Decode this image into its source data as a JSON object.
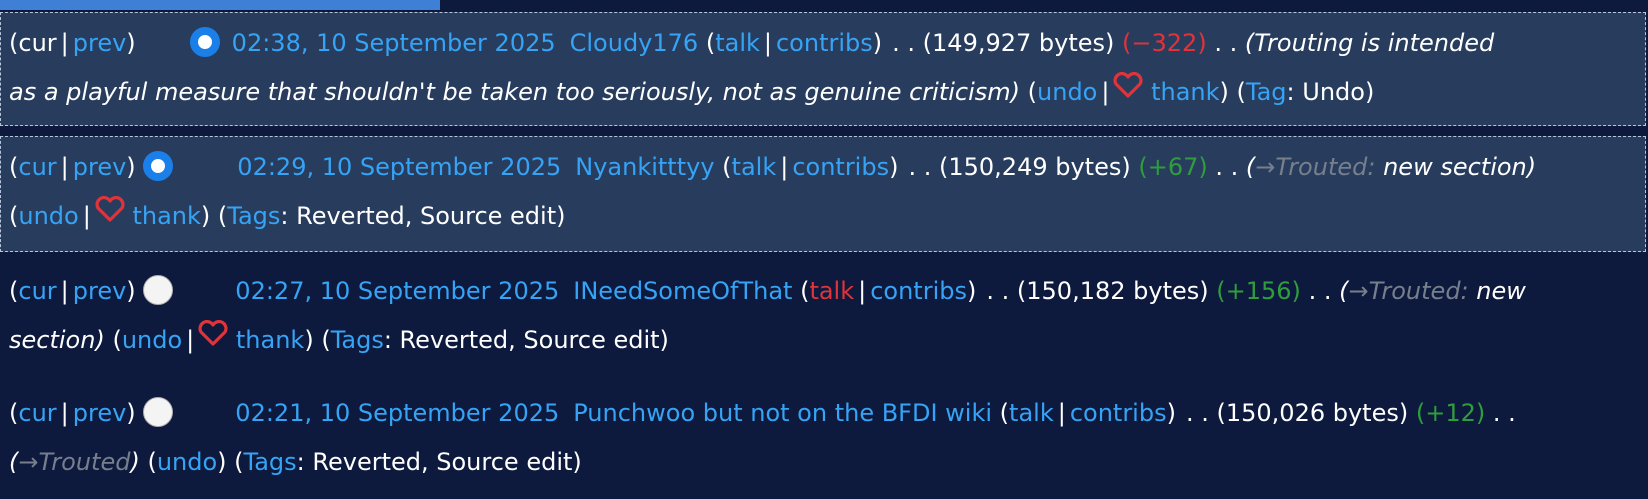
{
  "common": {
    "cur": "cur",
    "prev": "prev",
    "talk": "talk",
    "contribs": "contribs",
    "undo": "undo",
    "thank": "thank",
    "dots": ". .",
    "tag": "Tag",
    "tags": "Tags",
    "arrow": "→"
  },
  "entries": [
    {
      "timestamp": "02:38, 10 September 2025",
      "user": "Cloudy176",
      "bytes": "(149,927 bytes)",
      "diff": "(−322)",
      "summary_line1": "(Trouting is intended",
      "summary_line2": "as a playful measure that shouldn't be taken too seriously, not as genuine criticism)",
      "tag_values": ": Undo)"
    },
    {
      "timestamp": "02:29, 10 September 2025",
      "user": "Nyankitttyy",
      "bytes": "(150,249 bytes)",
      "diff": "(+67)",
      "section": "Trouted:",
      "summary_rest": "new section)",
      "tag_values": ": Reverted, Source edit)"
    },
    {
      "timestamp": "02:27, 10 September 2025",
      "user": "INeedSomeOfThat",
      "bytes": "(150,182 bytes)",
      "diff": "(+156)",
      "section": "Trouted:",
      "summary_rest_1": "new",
      "summary_rest_2": "section)",
      "tag_values": ": Reverted, Source edit)"
    },
    {
      "timestamp": "02:21, 10 September 2025",
      "user": "Punchwoo but not on the BFDI wiki",
      "bytes": "(150,026 bytes)",
      "diff": "(+12)",
      "section": "Trouted",
      "tag_values": ": Reverted, Source edit)"
    }
  ],
  "colors": {
    "background": "#0d1a3d",
    "selected_row": "#283d5e",
    "link": "#36a3f5",
    "negative": "#e0333a",
    "positive": "#2e9e3c",
    "autocomment": "#777f8c",
    "radio_selected": "#1a7fe8"
  },
  "icons": {
    "thank": "heart-icon"
  }
}
